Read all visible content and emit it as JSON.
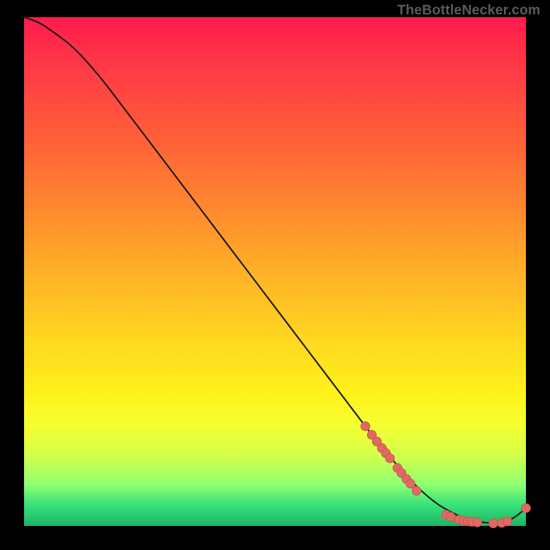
{
  "watermark_text": "TheBottleNecker.com",
  "colors": {
    "curve_stroke": "#1a1a1a",
    "marker_fill": "#e06a63",
    "marker_stroke": "#c85550"
  },
  "chart_data": {
    "type": "line",
    "title": "",
    "xlabel": "",
    "ylabel": "",
    "xlim": [
      0,
      100
    ],
    "ylim": [
      0,
      100
    ],
    "series": [
      {
        "name": "curve",
        "x": [
          0,
          3,
          6,
          10,
          15,
          20,
          25,
          30,
          35,
          40,
          45,
          50,
          55,
          60,
          65,
          70,
          73,
          76,
          79,
          82,
          85,
          88,
          91,
          94,
          96,
          98,
          100
        ],
        "y": [
          100,
          99,
          97,
          94,
          88.5,
          82,
          75.5,
          69,
          62.5,
          56,
          49.5,
          43,
          36.5,
          30,
          23.5,
          17,
          13.5,
          10,
          7,
          4.5,
          2.7,
          1.4,
          0.7,
          0.5,
          0.8,
          1.8,
          3.5
        ]
      }
    ],
    "markers": [
      {
        "x": 68.0,
        "y": 19.6
      },
      {
        "x": 69.3,
        "y": 17.9
      },
      {
        "x": 70.3,
        "y": 16.6
      },
      {
        "x": 71.3,
        "y": 15.3
      },
      {
        "x": 72.1,
        "y": 14.3
      },
      {
        "x": 72.9,
        "y": 13.3
      },
      {
        "x": 74.4,
        "y": 11.4
      },
      {
        "x": 75.2,
        "y": 10.4
      },
      {
        "x": 76.2,
        "y": 9.2
      },
      {
        "x": 77.0,
        "y": 8.3
      },
      {
        "x": 78.2,
        "y": 6.9
      },
      {
        "x": 84.1,
        "y": 2.2
      },
      {
        "x": 85.0,
        "y": 1.8
      },
      {
        "x": 86.7,
        "y": 1.2
      },
      {
        "x": 87.6,
        "y": 1.0
      },
      {
        "x": 88.4,
        "y": 0.9
      },
      {
        "x": 89.2,
        "y": 0.8
      },
      {
        "x": 90.3,
        "y": 0.7
      },
      {
        "x": 93.5,
        "y": 0.5
      },
      {
        "x": 95.2,
        "y": 0.6
      },
      {
        "x": 96.3,
        "y": 0.9
      },
      {
        "x": 100.0,
        "y": 3.5
      }
    ]
  }
}
